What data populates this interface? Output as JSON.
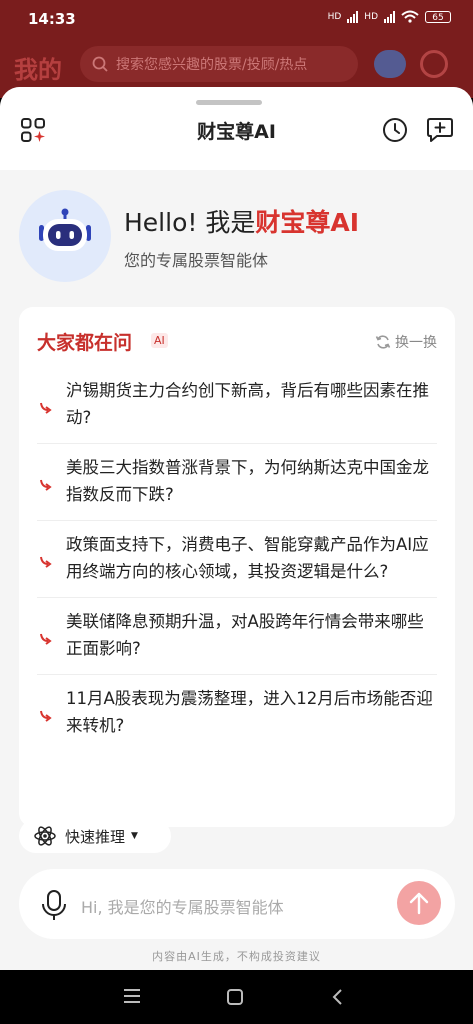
{
  "status": {
    "time": "14:33",
    "net1": "HD",
    "net2": "HD",
    "battery": "65"
  },
  "background": {
    "title": "我的",
    "search_placeholder": "搜索您感兴趣的股票/投顾/热点"
  },
  "sheet": {
    "title": "财宝尊AI"
  },
  "greeting": {
    "hello": "Hello!",
    "prefix": "我是",
    "brand": "财宝尊AI",
    "subtitle": "您的专属股票智能体"
  },
  "questions_card": {
    "title": "大家都在问",
    "badge": "AI",
    "refresh_label": "换一换",
    "items": [
      "沪锡期货主力合约创下新高，背后有哪些因素在推动?",
      "美股三大指数普涨背景下，为何纳斯达克中国金龙指数反而下跌?",
      "政策面支持下，消费电子、智能穿戴产品作为AI应用终端方向的核心领域，其投资逻辑是什么?",
      "美联储降息预期升温，对A股跨年行情会带来哪些正面影响?",
      "11月A股表现为震荡整理，进入12月后市场能否迎来转机?"
    ]
  },
  "quick_reasoning": {
    "label": "快速推理"
  },
  "input": {
    "placeholder": "Hi, 我是您的专属股票智能体"
  },
  "disclaimer": "内容由AI生成，不构成投资建议",
  "colors": {
    "brand_red": "#d8342f",
    "header_dark_red": "#7a1d1d",
    "send_button": "#f3a3a3"
  }
}
